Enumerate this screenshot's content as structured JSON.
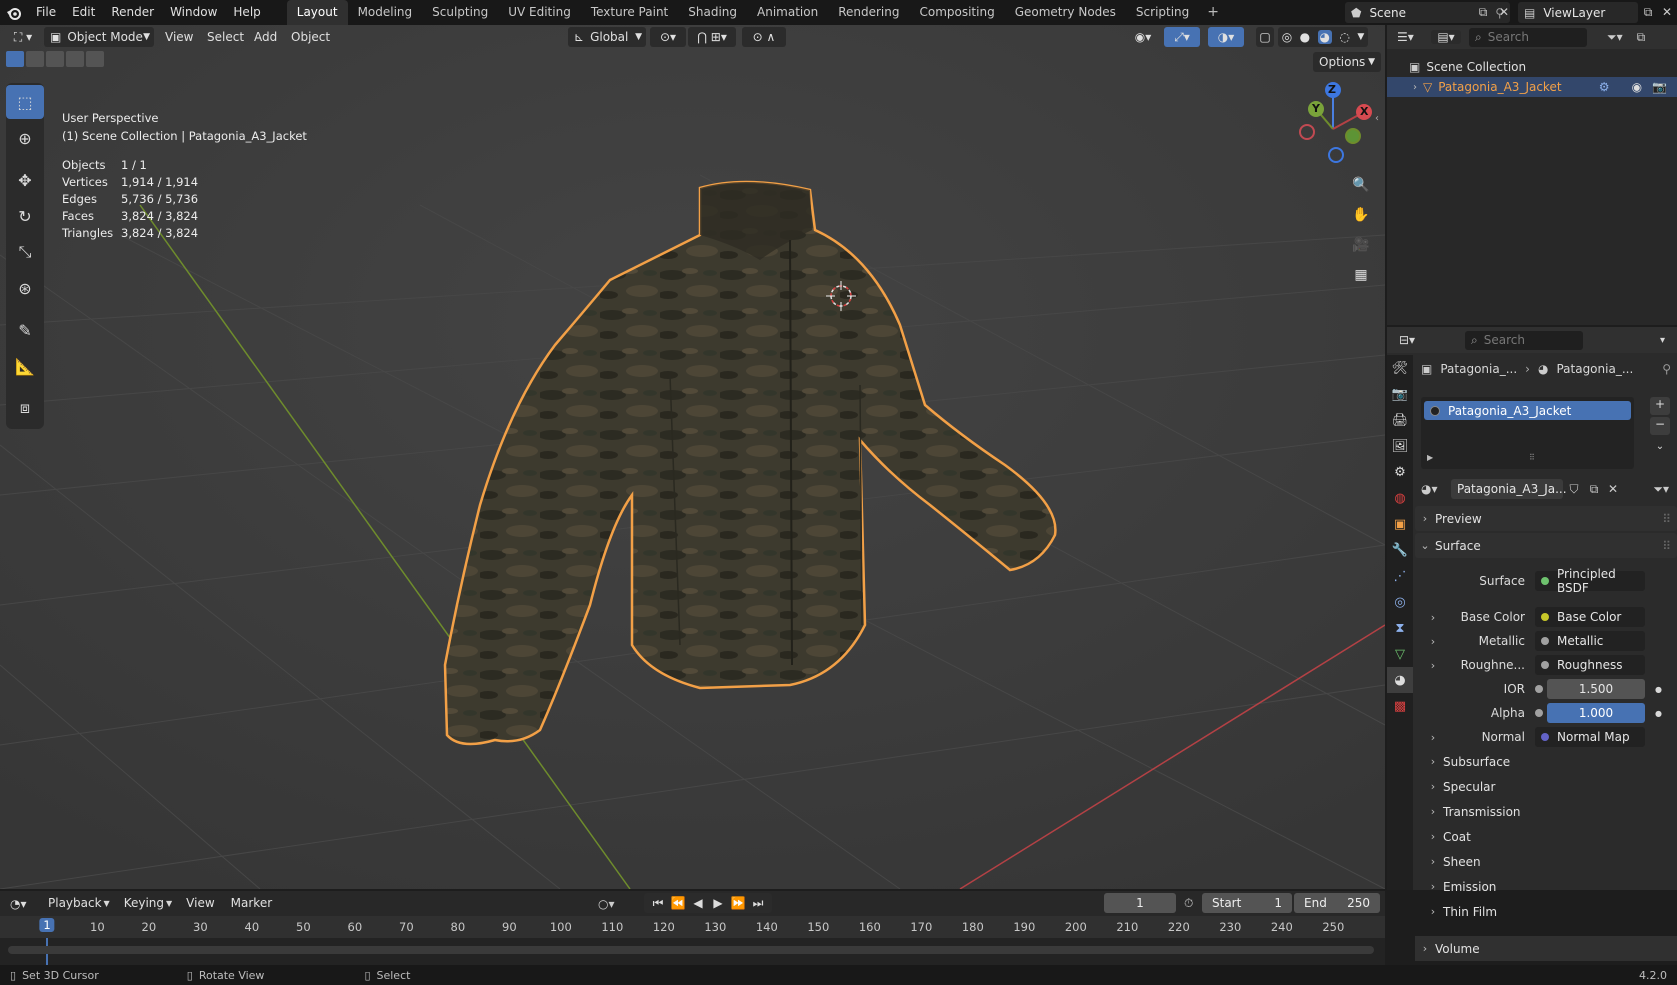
{
  "menu": {
    "items": [
      "File",
      "Edit",
      "Render",
      "Window",
      "Help"
    ],
    "workspaces": [
      "Layout",
      "Modeling",
      "Sculpting",
      "UV Editing",
      "Texture Paint",
      "Shading",
      "Animation",
      "Rendering",
      "Compositing",
      "Geometry Nodes",
      "Scripting"
    ],
    "active_workspace": "Layout",
    "scene": "Scene",
    "view_layer": "ViewLayer"
  },
  "viewport": {
    "mode": "Object Mode",
    "menus": [
      "View",
      "Select",
      "Add",
      "Object"
    ],
    "orientation": "Global",
    "options": "Options",
    "perspective": "User Perspective",
    "collection_path": "(1) Scene Collection | Patagonia_A3_Jacket",
    "stats": [
      {
        "label": "Objects",
        "value": "1 / 1"
      },
      {
        "label": "Vertices",
        "value": "1,914 / 1,914"
      },
      {
        "label": "Edges",
        "value": "5,736 / 5,736"
      },
      {
        "label": "Faces",
        "value": "3,824 / 3,824"
      },
      {
        "label": "Triangles",
        "value": "3,824 / 3,824"
      }
    ],
    "gizmo": {
      "x": "X",
      "y": "Y",
      "z": "Z"
    },
    "colors": {
      "selection_outline": "#f2a047",
      "x_axis": "#b34145",
      "y_axis": "#6e8c2c",
      "active": "#4772b3"
    }
  },
  "outliner": {
    "search_placeholder": "Search",
    "root": "Scene Collection",
    "object": "Patagonia_A3_Jacket"
  },
  "properties": {
    "search_placeholder": "Search",
    "breadcrumb_object": "Patagonia_...",
    "breadcrumb_material": "Patagonia_...",
    "material_slot": "Patagonia_A3_Jacket",
    "material_name": "Patagonia_A3_Ja...",
    "panels": {
      "preview": "Preview",
      "surface": "Surface",
      "volume": "Volume"
    },
    "surface_label": "Surface",
    "surface_shader": "Principled BSDF",
    "inputs": [
      {
        "label": "Base Color",
        "value": "Base Color",
        "socket": "#c7c729",
        "expand": true
      },
      {
        "label": "Metallic",
        "value": "Metallic",
        "socket": "#a1a1a1",
        "expand": true
      },
      {
        "label": "Roughne...",
        "value": "Roughness",
        "socket": "#a1a1a1",
        "expand": true
      },
      {
        "label": "IOR",
        "value": "1.500",
        "socket": "#a1a1a1",
        "expand": false,
        "kind": "num"
      },
      {
        "label": "Alpha",
        "value": "1.000",
        "socket": "#a1a1a1",
        "expand": false,
        "kind": "blue"
      },
      {
        "label": "Normal",
        "value": "Normal Map",
        "socket": "#6363c7",
        "expand": true
      }
    ],
    "subpanels": [
      "Subsurface",
      "Specular",
      "Transmission",
      "Coat",
      "Sheen",
      "Emission",
      "Thin Film"
    ]
  },
  "timeline": {
    "menus": [
      "Playback",
      "Keying",
      "View",
      "Marker"
    ],
    "current_frame": "1",
    "start_label": "Start",
    "start": "1",
    "end_label": "End",
    "end": "250",
    "ticks": [
      "1",
      "10",
      "20",
      "30",
      "40",
      "50",
      "60",
      "70",
      "80",
      "90",
      "100",
      "110",
      "120",
      "130",
      "140",
      "150",
      "160",
      "170",
      "180",
      "190",
      "200",
      "210",
      "220",
      "230",
      "240",
      "250"
    ]
  },
  "status": {
    "left": "Set 3D Cursor",
    "middle": "Rotate View",
    "right": "Select",
    "version": "4.2.0"
  }
}
